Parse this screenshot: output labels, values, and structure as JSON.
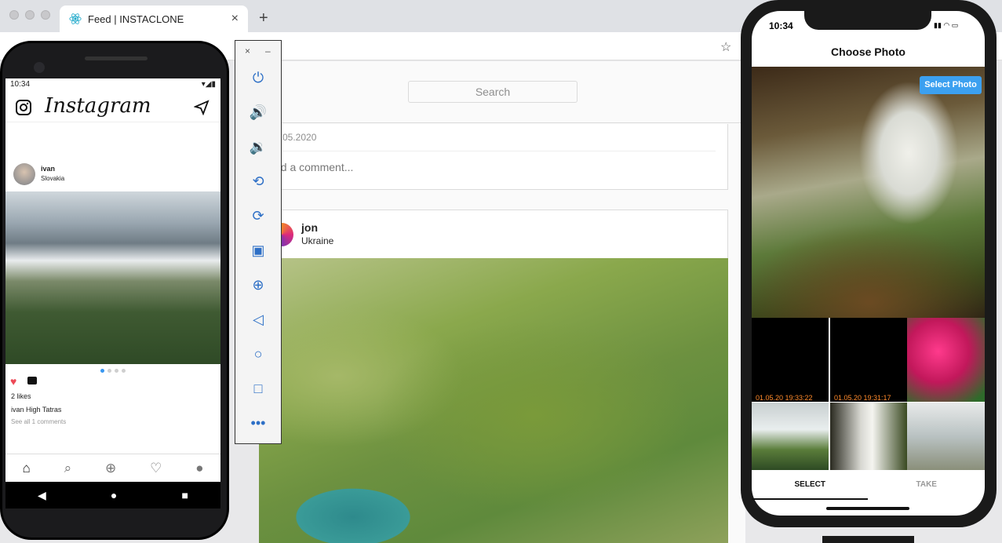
{
  "browser": {
    "tab_title": "Feed | INSTACLONE",
    "close_icon": "×",
    "new_tab_icon": "+",
    "star_icon": "☆"
  },
  "web": {
    "search_placeholder": "Search",
    "post1_date": "05.2020",
    "comment_placeholder": "dd a comment...",
    "post2_user": "jon",
    "post2_location": "Ukraine"
  },
  "android": {
    "status_time": "10:34",
    "app_title": "Instagram",
    "post_user": "ivan",
    "post_location": "Slovakia",
    "likes": "2 likes",
    "caption": "ivan High Tatras",
    "comments_link": "See all 1 comments",
    "carousel_active_index": 0
  },
  "emulator": {
    "close": "×",
    "minimize": "–"
  },
  "iphone": {
    "status_time": "10:34",
    "title": "Choose Photo",
    "select_button": "Select Photo",
    "thumb1_timestamp": "01.05.20 19:33:22",
    "thumb2_timestamp": "01.05.20 19:31:17",
    "tab_select": "SELECT",
    "tab_take": "TAKE"
  }
}
